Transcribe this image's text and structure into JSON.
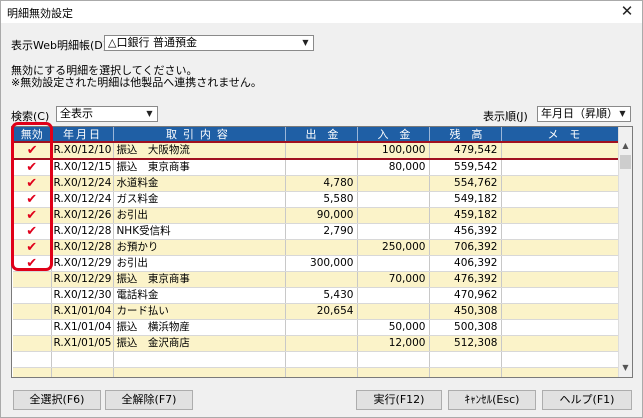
{
  "window": {
    "title": "明細無効設定",
    "close_glyph": "✕"
  },
  "account": {
    "label": "表示Web明細帳(D)",
    "value": "△口銀行  普通預金"
  },
  "messages": [
    "無効にする明細を選択してください。",
    "※無効設定された明細は他製品へ連携されません。"
  ],
  "search": {
    "label": "検索(C)",
    "value": "全表示"
  },
  "sort": {
    "label": "表示順(J)",
    "value": "年月日（昇順）"
  },
  "table": {
    "headers": [
      "無効",
      "年月日",
      "取引内容",
      "出　金",
      "入　金",
      "残　高",
      "メ　モ"
    ],
    "rows": [
      {
        "checked": true,
        "date": "R.X0/12/10",
        "desc": "振込　大阪物流",
        "out": "",
        "in": "100,000",
        "bal": "479,542",
        "memo": ""
      },
      {
        "checked": true,
        "date": "R.X0/12/15",
        "desc": "振込　東京商事",
        "out": "",
        "in": "80,000",
        "bal": "559,542",
        "memo": ""
      },
      {
        "checked": true,
        "date": "R.X0/12/24",
        "desc": "水道料金",
        "out": "4,780",
        "in": "",
        "bal": "554,762",
        "memo": ""
      },
      {
        "checked": true,
        "date": "R.X0/12/24",
        "desc": "ガス料金",
        "out": "5,580",
        "in": "",
        "bal": "549,182",
        "memo": ""
      },
      {
        "checked": true,
        "date": "R.X0/12/26",
        "desc": "お引出",
        "out": "90,000",
        "in": "",
        "bal": "459,182",
        "memo": ""
      },
      {
        "checked": true,
        "date": "R.X0/12/28",
        "desc": "NHK受信料",
        "out": "2,790",
        "in": "",
        "bal": "456,392",
        "memo": ""
      },
      {
        "checked": true,
        "date": "R.X0/12/28",
        "desc": "お預かり",
        "out": "",
        "in": "250,000",
        "bal": "706,392",
        "memo": ""
      },
      {
        "checked": true,
        "date": "R.X0/12/29",
        "desc": "お引出",
        "out": "300,000",
        "in": "",
        "bal": "406,392",
        "memo": ""
      },
      {
        "checked": false,
        "date": "R.X0/12/29",
        "desc": "振込　東京商事",
        "out": "",
        "in": "70,000",
        "bal": "476,392",
        "memo": ""
      },
      {
        "checked": false,
        "date": "R.X0/12/30",
        "desc": "電話料金",
        "out": "5,430",
        "in": "",
        "bal": "470,962",
        "memo": ""
      },
      {
        "checked": false,
        "date": "R.X1/01/04",
        "desc": "カード払い",
        "out": "20,654",
        "in": "",
        "bal": "450,308",
        "memo": ""
      },
      {
        "checked": false,
        "date": "R.X1/01/04",
        "desc": "振込　横浜物産",
        "out": "",
        "in": "50,000",
        "bal": "500,308",
        "memo": ""
      },
      {
        "checked": false,
        "date": "R.X1/01/05",
        "desc": "振込　金沢商店",
        "out": "",
        "in": "12,000",
        "bal": "512,308",
        "memo": ""
      }
    ],
    "empty_rows": 2,
    "check_glyph": "✔"
  },
  "buttons": {
    "select_all": "全選択(F6)",
    "deselect_all": "全解除(F7)",
    "run": "実行(F12)",
    "cancel": "ｷｬﾝｾﾙ(Esc)",
    "help": "ヘルプ(F1)"
  },
  "colors": {
    "header_bg": "#1f5fa5",
    "alt_row": "#fbf3c9",
    "check": "#e0001b",
    "highlight": "#e00018"
  }
}
